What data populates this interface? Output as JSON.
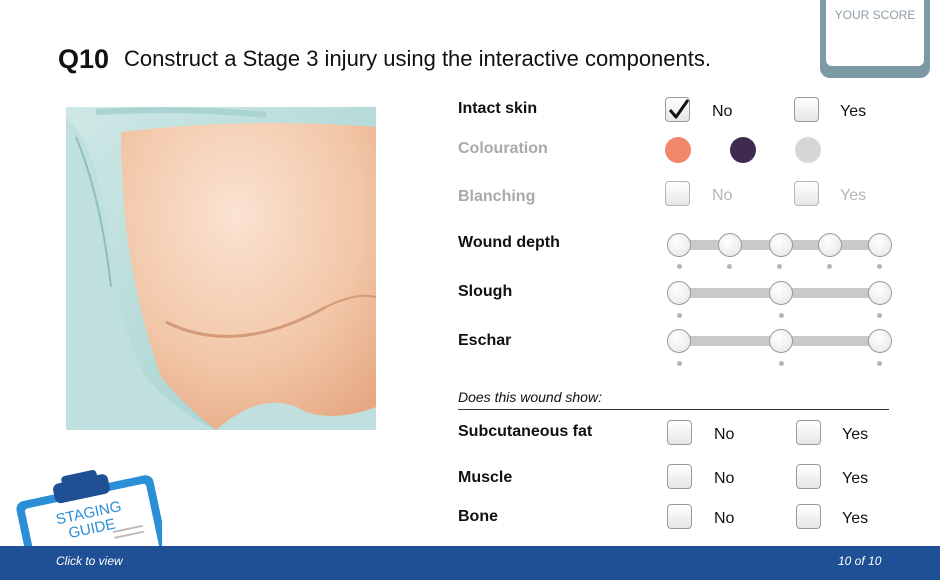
{
  "score": {
    "label": "YOUR SCORE"
  },
  "question": {
    "number": "Q10",
    "text": "Construct a Stage 3 injury using the interactive components."
  },
  "rows": {
    "intact_skin": {
      "label": "Intact skin",
      "no": "No",
      "yes": "Yes",
      "selected": "No"
    },
    "colouration": {
      "label": "Colouration",
      "colors": [
        "#f2866a",
        "#3e2b4f",
        "#d6d6d6"
      ]
    },
    "blanching": {
      "label": "Blanching",
      "no": "No",
      "yes": "Yes"
    },
    "wound_depth": {
      "label": "Wound depth",
      "levels": 5
    },
    "slough": {
      "label": "Slough",
      "levels": 3
    },
    "eschar": {
      "label": "Eschar",
      "levels": 3
    }
  },
  "shows": {
    "heading": "Does this wound show:",
    "subcutaneous_fat": {
      "label": "Subcutaneous fat",
      "no": "No",
      "yes": "Yes"
    },
    "muscle": {
      "label": "Muscle",
      "no": "No",
      "yes": "Yes"
    },
    "bone": {
      "label": "Bone",
      "no": "No",
      "yes": "Yes"
    }
  },
  "guide": {
    "line1": "STAGING",
    "line2": "GUIDE"
  },
  "footer": {
    "left": "Click to view",
    "right": "10 of 10"
  }
}
